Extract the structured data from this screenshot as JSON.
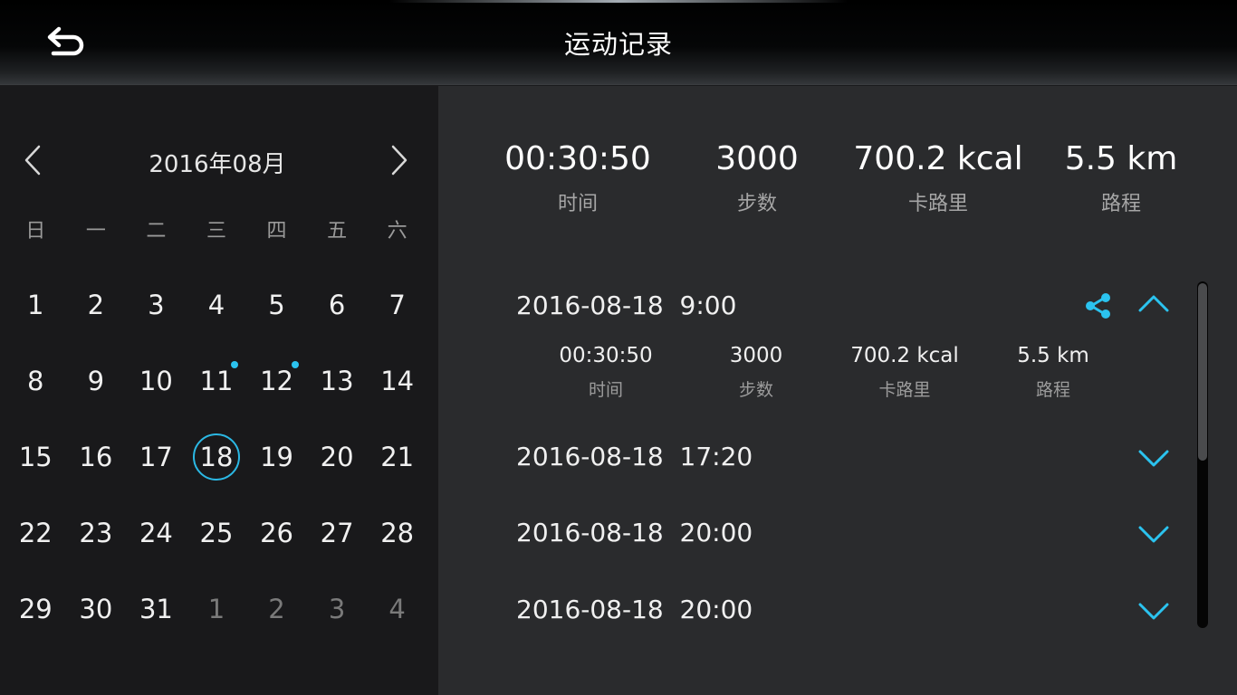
{
  "header": {
    "title": "运动记录",
    "back_icon": "back-arrow-icon"
  },
  "calendar": {
    "month_label": "2016年08月",
    "weekdays": [
      "日",
      "一",
      "二",
      "三",
      "四",
      "五",
      "六"
    ],
    "days": [
      {
        "label": "1",
        "current": true
      },
      {
        "label": "2",
        "current": true
      },
      {
        "label": "3",
        "current": true
      },
      {
        "label": "4",
        "current": true
      },
      {
        "label": "5",
        "current": true
      },
      {
        "label": "6",
        "current": true
      },
      {
        "label": "7",
        "current": true
      },
      {
        "label": "8",
        "current": true
      },
      {
        "label": "9",
        "current": true
      },
      {
        "label": "10",
        "current": true
      },
      {
        "label": "11",
        "current": true,
        "has_record": true
      },
      {
        "label": "12",
        "current": true,
        "has_record": true
      },
      {
        "label": "13",
        "current": true
      },
      {
        "label": "14",
        "current": true
      },
      {
        "label": "15",
        "current": true
      },
      {
        "label": "16",
        "current": true
      },
      {
        "label": "17",
        "current": true
      },
      {
        "label": "18",
        "current": true,
        "selected": true
      },
      {
        "label": "19",
        "current": true
      },
      {
        "label": "20",
        "current": true
      },
      {
        "label": "21",
        "current": true
      },
      {
        "label": "22",
        "current": true
      },
      {
        "label": "23",
        "current": true
      },
      {
        "label": "24",
        "current": true
      },
      {
        "label": "25",
        "current": true
      },
      {
        "label": "26",
        "current": true
      },
      {
        "label": "27",
        "current": true
      },
      {
        "label": "28",
        "current": true
      },
      {
        "label": "29",
        "current": true
      },
      {
        "label": "30",
        "current": true
      },
      {
        "label": "31",
        "current": true
      },
      {
        "label": "1",
        "current": false
      },
      {
        "label": "2",
        "current": false
      },
      {
        "label": "3",
        "current": false
      },
      {
        "label": "4",
        "current": false
      }
    ],
    "accent_color": "#2bb8e4"
  },
  "summary": {
    "time": {
      "value": "00:30:50",
      "label": "时间"
    },
    "steps": {
      "value": "3000",
      "label": "步数"
    },
    "calories": {
      "value": "700.2 kcal",
      "label": "卡路里"
    },
    "distance": {
      "value": "5.5 km",
      "label": "路程"
    }
  },
  "records": [
    {
      "time": "2016-08-18  9:00",
      "expanded": true,
      "detail": {
        "time": {
          "value": "00:30:50",
          "label": "时间"
        },
        "steps": {
          "value": "3000",
          "label": "步数"
        },
        "calories": {
          "value": "700.2 kcal",
          "label": "卡路里"
        },
        "distance": {
          "value": "5.5 km",
          "label": "路程"
        }
      }
    },
    {
      "time": "2016-08-18  17:20",
      "expanded": false
    },
    {
      "time": "2016-08-18  20:00",
      "expanded": false
    },
    {
      "time": "2016-08-18  20:00",
      "expanded": false
    }
  ]
}
